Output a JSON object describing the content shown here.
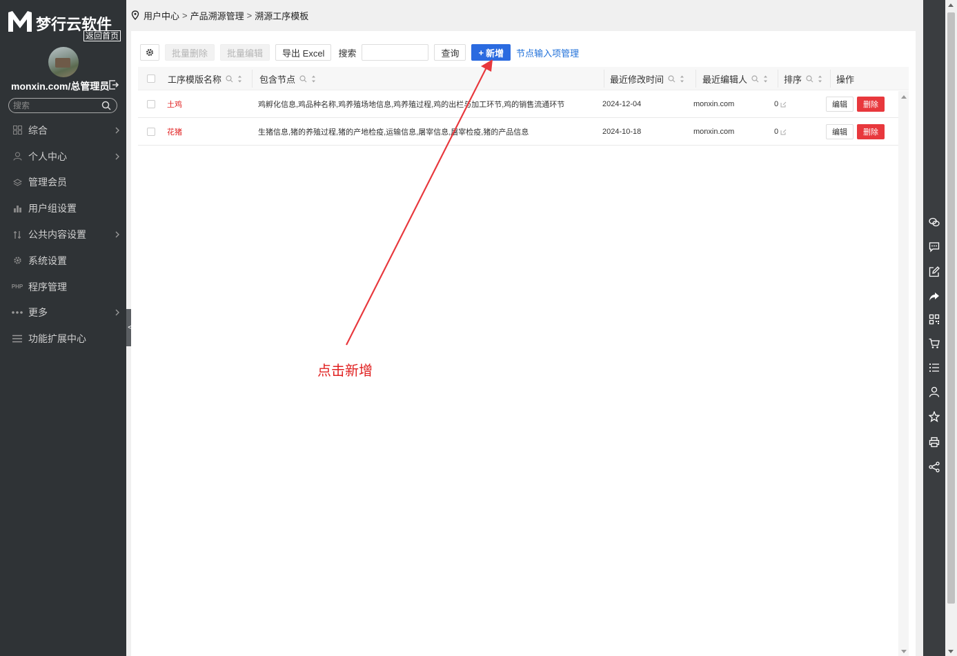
{
  "brand": {
    "name": "梦行云软件",
    "home_link": "返回首页"
  },
  "user": {
    "name": "monxin.com/总管理员"
  },
  "sidebar_search": {
    "placeholder": "搜索"
  },
  "menu": [
    {
      "label": "综合",
      "icon": "grid-icon",
      "has_children": true
    },
    {
      "label": "个人中心",
      "icon": "user-icon",
      "has_children": true
    },
    {
      "label": "管理会员",
      "icon": "layers-icon",
      "has_children": false
    },
    {
      "label": "用户组设置",
      "icon": "chart-icon",
      "has_children": false
    },
    {
      "label": "公共内容设置",
      "icon": "tools-icon",
      "has_children": true
    },
    {
      "label": "系统设置",
      "icon": "gear-icon",
      "has_children": false
    },
    {
      "label": "程序管理",
      "icon": "php-icon",
      "icon_text": "PHP",
      "has_children": false
    },
    {
      "label": "更多",
      "icon": "more-dots-icon",
      "has_children": true
    },
    {
      "label": "功能扩展中心",
      "icon": "hamburger-icon",
      "has_children": false
    }
  ],
  "collapse_tab": {
    "label": "<"
  },
  "breadcrumb": [
    "用户中心",
    "产品溯源管理",
    "溯源工序模板"
  ],
  "breadcrumb_separator": ">",
  "toolbar": {
    "batch_delete": "批量删除",
    "batch_edit": "批量编辑",
    "export_excel": "导出 Excel",
    "search_label": "搜索",
    "search_value": "",
    "query": "查询",
    "add": "新增",
    "add_prefix": "+",
    "node_input_manage": "节点输入项管理"
  },
  "table": {
    "columns": [
      "工序模版名称",
      "包含节点",
      "最近修改时间",
      "最近编辑人",
      "排序",
      "操作"
    ],
    "rows": [
      {
        "name": "土鸡",
        "nodes": "鸡孵化信息,鸡品种名称,鸡养殖场地信息,鸡养殖过程,鸡的出栏与加工环节,鸡的销售流通环节",
        "modified": "2024-12-04",
        "editor": "monxin.com",
        "order": "0",
        "edit": "编辑",
        "delete": "删除"
      },
      {
        "name": "花猪",
        "nodes": "生猪信息,猪的养殖过程,猪的产地检疫,运输信息,屠宰信息,屠宰检疫,猪的产品信息",
        "modified": "2024-10-18",
        "editor": "monxin.com",
        "order": "0",
        "edit": "编辑",
        "delete": "删除"
      }
    ]
  },
  "annotation": {
    "text": "点击新增",
    "color": "#e02020"
  },
  "right_toolbar": [
    "wechat-icon",
    "comment-icon",
    "edit-icon",
    "share-arrow-icon",
    "qrcode-icon",
    "cart-icon",
    "list-icon",
    "user-icon",
    "star-icon",
    "print-icon",
    "share-icon"
  ],
  "colors": {
    "sidebar_bg": "#2f3336",
    "primary": "#2b6be0",
    "danger": "#e8383d",
    "link": "#1e6fd9"
  }
}
